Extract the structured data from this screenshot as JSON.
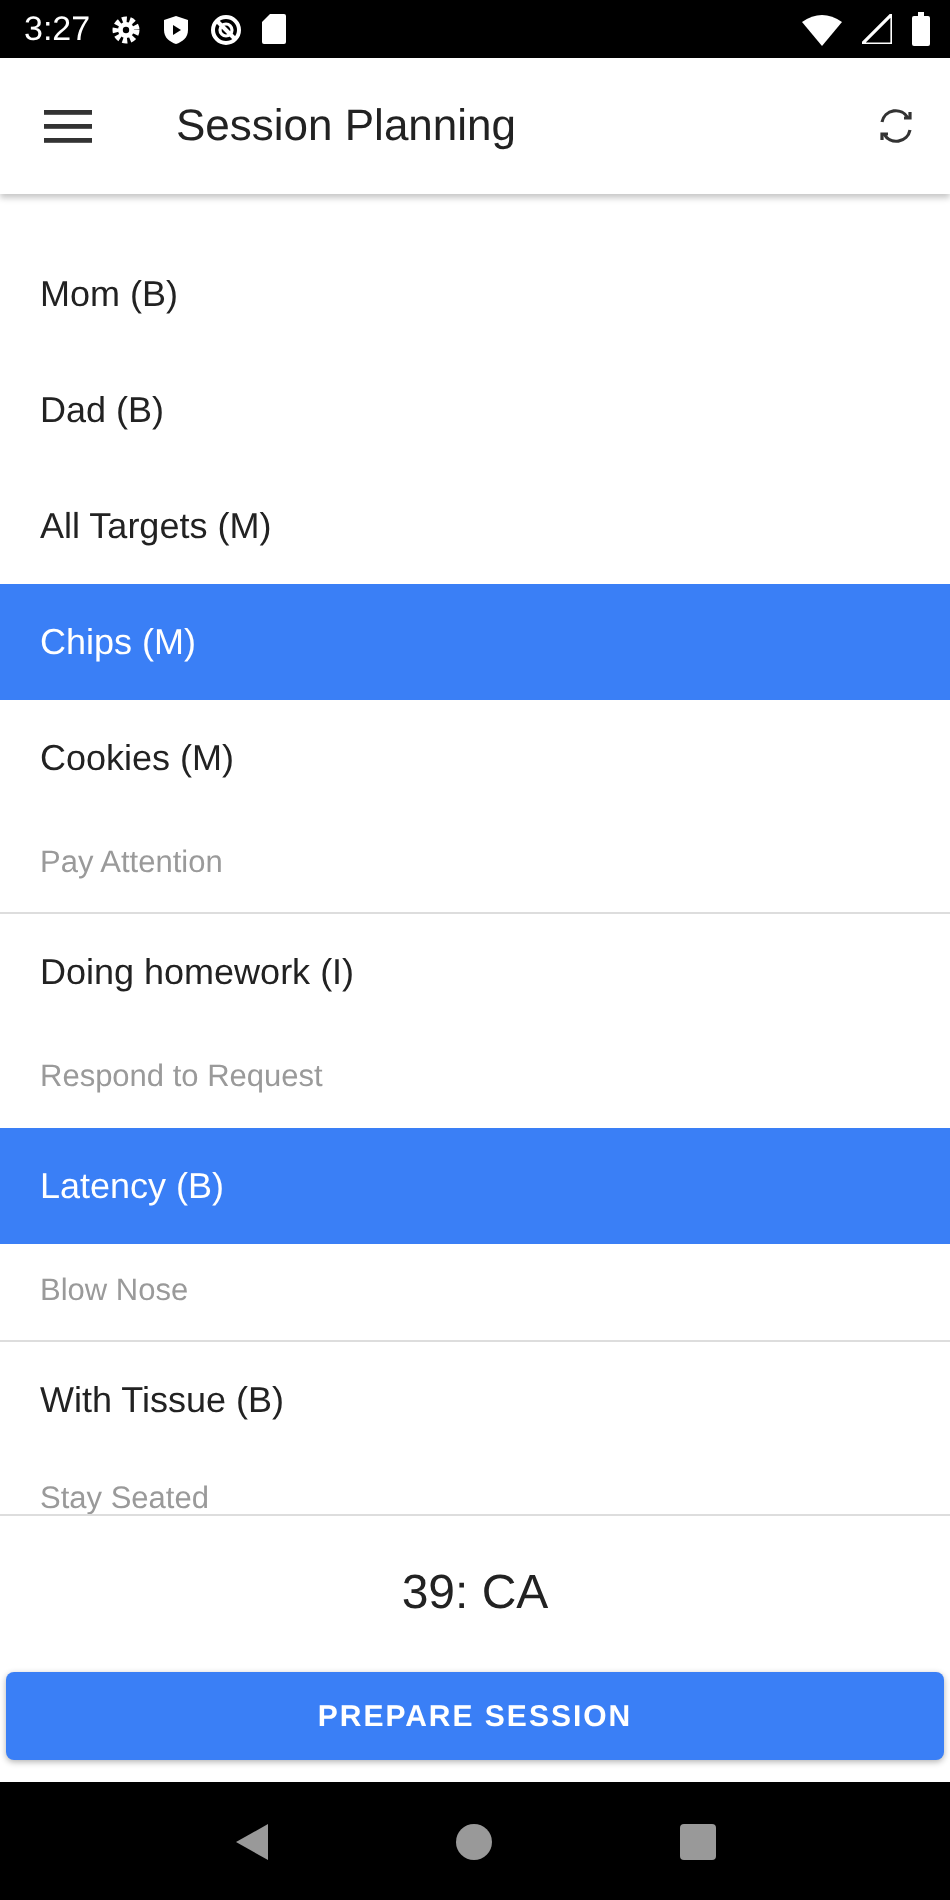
{
  "status_bar": {
    "time": "3:27"
  },
  "app_bar": {
    "title": "Session Planning"
  },
  "list": [
    {
      "kind": "item",
      "label": "Mom (B)",
      "selected": false
    },
    {
      "kind": "item",
      "label": "Dad (B)",
      "selected": false
    },
    {
      "kind": "item",
      "label": "All Targets (M)",
      "selected": false
    },
    {
      "kind": "item",
      "label": "Chips (M)",
      "selected": true
    },
    {
      "kind": "item",
      "label": "Cookies (M)",
      "selected": false
    },
    {
      "kind": "header",
      "label": "Pay Attention"
    },
    {
      "kind": "item",
      "label": "Doing homework (I)",
      "selected": false
    },
    {
      "kind": "header",
      "label": "Respond to Request"
    },
    {
      "kind": "item",
      "label": "Latency (B)",
      "selected": true
    },
    {
      "kind": "header",
      "label": "Blow Nose"
    },
    {
      "kind": "item",
      "label": "With Tissue (B)",
      "selected": false
    },
    {
      "kind": "header",
      "label": "Stay Seated"
    }
  ],
  "footer": {
    "summary": "39: CA",
    "button": "PREPARE SESSION"
  }
}
